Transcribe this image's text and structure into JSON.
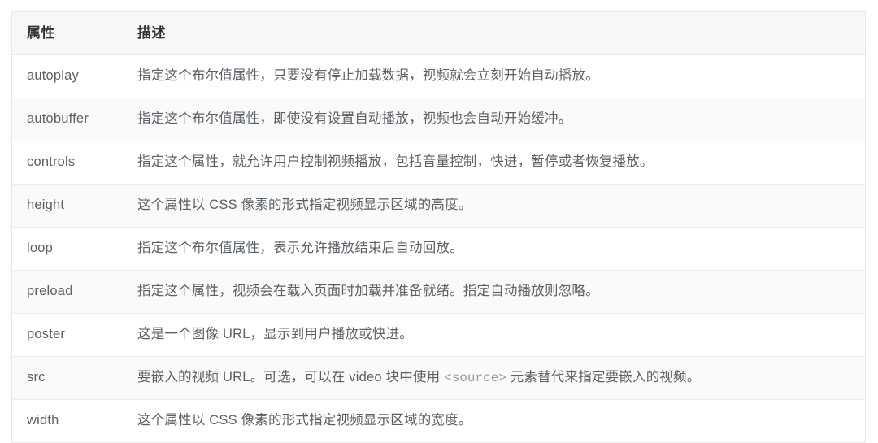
{
  "table": {
    "columns": [
      {
        "key": "attribute",
        "label": "属性"
      },
      {
        "key": "description",
        "label": "描述"
      }
    ],
    "rows": [
      {
        "attribute": "autoplay",
        "description": "指定这个布尔值属性，只要没有停止加载数据，视频就会立刻开始自动播放。"
      },
      {
        "attribute": "autobuffer",
        "description": "指定这个布尔值属性，即使没有设置自动播放，视频也会自动开始缓冲。"
      },
      {
        "attribute": "controls",
        "description": "指定这个属性，就允许用户控制视频播放，包括音量控制，快进，暂停或者恢复播放。"
      },
      {
        "attribute": "height",
        "description": "这个属性以 CSS 像素的形式指定视频显示区域的高度。"
      },
      {
        "attribute": "loop",
        "description": "指定这个布尔值属性，表示允许播放结束后自动回放。"
      },
      {
        "attribute": "preload",
        "description": "指定这个属性，视频会在载入页面时加载并准备就绪。指定自动播放则忽略。"
      },
      {
        "attribute": "poster",
        "description": "这是一个图像 URL，显示到用户播放或快进。"
      },
      {
        "attribute": "src",
        "description_prefix": "要嵌入的视频 URL。可选，可以在 video 块中使用 ",
        "description_code": "<source>",
        "description_suffix": " 元素替代来指定要嵌入的视频。"
      },
      {
        "attribute": "width",
        "description": "这个属性以 CSS 像素的形式指定视频显示区域的宽度。"
      }
    ]
  },
  "colors": {
    "header_background": "#f7f7f7",
    "stripe_background": "#fafafa",
    "row_background": "#ffffff",
    "border": "#ededed",
    "header_text": "#2f3437",
    "body_text": "#4f5358",
    "code_text": "#9a9a9a"
  }
}
